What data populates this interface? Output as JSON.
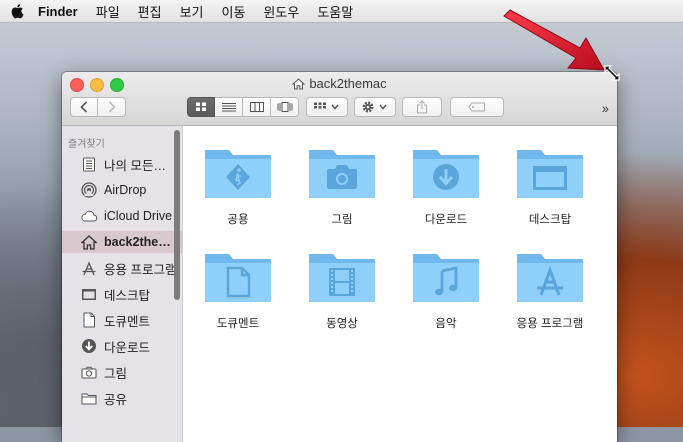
{
  "menubar": {
    "app": "Finder",
    "items": [
      "파일",
      "편집",
      "보기",
      "이동",
      "윈도우",
      "도움말"
    ]
  },
  "window": {
    "title": "back2themac"
  },
  "sidebar": {
    "header": "즐겨찾기",
    "items": [
      {
        "label": "나의 모든…",
        "icon": "all-files-icon"
      },
      {
        "label": "AirDrop",
        "icon": "airdrop-icon"
      },
      {
        "label": "iCloud Drive",
        "icon": "cloud-icon"
      },
      {
        "label": "back2the…",
        "icon": "home-icon",
        "selected": true
      },
      {
        "label": "응용 프로그램",
        "icon": "applications-icon"
      },
      {
        "label": "데스크탑",
        "icon": "desktop-icon"
      },
      {
        "label": "도큐멘트",
        "icon": "document-icon"
      },
      {
        "label": "다운로드",
        "icon": "download-icon"
      },
      {
        "label": "그림",
        "icon": "camera-icon"
      },
      {
        "label": "공유",
        "icon": "folder-icon"
      }
    ]
  },
  "folders": [
    {
      "label": "공용",
      "icon": "public-folder-icon"
    },
    {
      "label": "그림",
      "icon": "pictures-folder-icon"
    },
    {
      "label": "다운로드",
      "icon": "downloads-folder-icon"
    },
    {
      "label": "데스크탑",
      "icon": "desktop-folder-icon"
    },
    {
      "label": "도큐멘트",
      "icon": "documents-folder-icon"
    },
    {
      "label": "동영상",
      "icon": "movies-folder-icon"
    },
    {
      "label": "음악",
      "icon": "music-folder-icon"
    },
    {
      "label": "응용 프로그램",
      "icon": "applications-folder-icon"
    }
  ],
  "colors": {
    "folder_blue": "#7cc3f4",
    "selection": "#d9c8cd",
    "annotation_arrow": "#d8162b"
  }
}
